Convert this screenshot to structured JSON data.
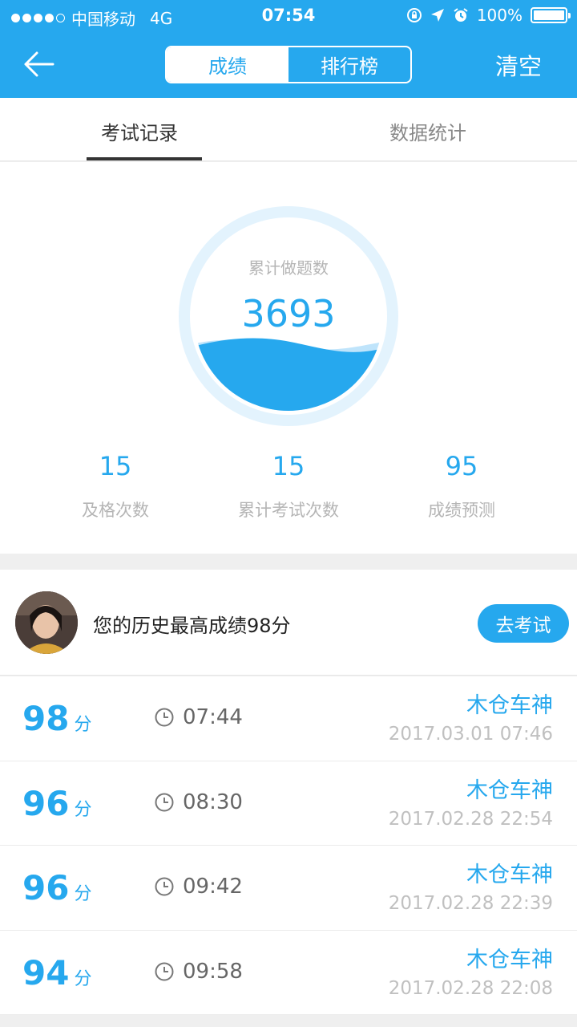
{
  "status": {
    "carrier": "中国移动",
    "network": "4G",
    "time": "07:54",
    "battery": "100%"
  },
  "header": {
    "tabs": [
      {
        "label": "成绩",
        "active": true
      },
      {
        "label": "排行榜",
        "active": false
      }
    ],
    "clear_label": "清空"
  },
  "subtabs": [
    {
      "label": "考试记录",
      "active": true
    },
    {
      "label": "数据统计",
      "active": false
    }
  ],
  "summary": {
    "circle_label": "累计做题数",
    "circle_value": "3693",
    "stats": [
      {
        "value": "15",
        "label": "及格次数"
      },
      {
        "value": "15",
        "label": "累计考试次数"
      },
      {
        "value": "95",
        "label": "成绩预测"
      }
    ]
  },
  "best": {
    "text": "您的历史最高成绩98分",
    "button": "去考试"
  },
  "records": [
    {
      "score": "98",
      "unit": "分",
      "duration": "07:44",
      "user": "木仓车神",
      "date": "2017.03.01 07:46"
    },
    {
      "score": "96",
      "unit": "分",
      "duration": "08:30",
      "user": "木仓车神",
      "date": "2017.02.28 22:54"
    },
    {
      "score": "96",
      "unit": "分",
      "duration": "09:42",
      "user": "木仓车神",
      "date": "2017.02.28 22:39"
    },
    {
      "score": "94",
      "unit": "分",
      "duration": "09:58",
      "user": "木仓车神",
      "date": "2017.02.28 22:08"
    }
  ],
  "colors": {
    "accent": "#26a8ee",
    "muted": "#b5b5b5"
  }
}
